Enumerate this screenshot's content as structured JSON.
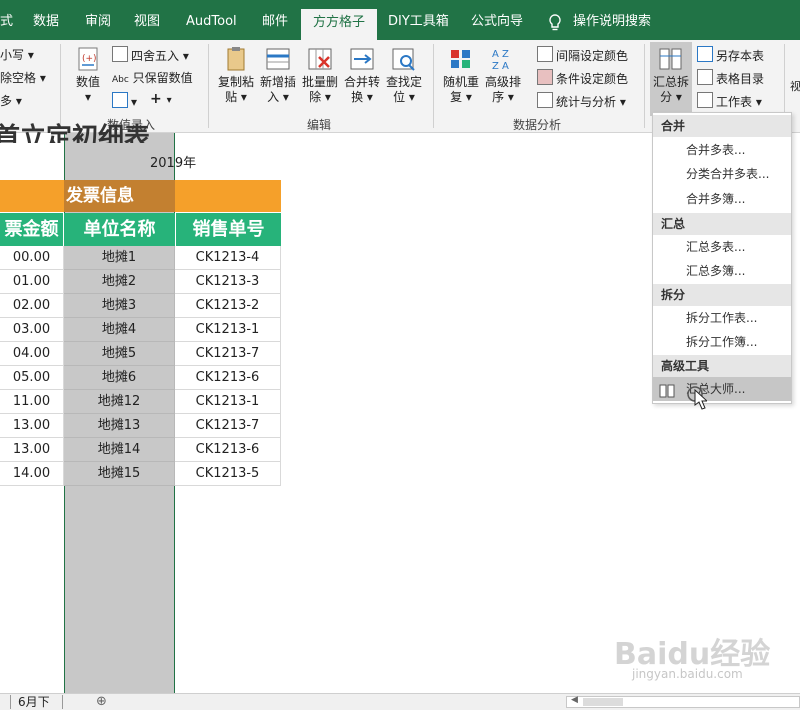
{
  "ribbon_tabs": [
    "式",
    "数据",
    "审阅",
    "视图",
    "AudTool",
    "邮件",
    "方方格子",
    "DIY工具箱",
    "公式向导",
    "操作说明搜索"
  ],
  "ribbon": {
    "left_items": [
      "小写",
      "除空格",
      "多"
    ],
    "numeric_group": {
      "value_button": "数值",
      "round_label": "四舍五入",
      "abc_prefix": "Abc",
      "keep_value_label": "只保留数值",
      "plus": "+",
      "group_label": "数值录入"
    },
    "edit_group": {
      "buttons": [
        [
          "复制粘",
          "贴"
        ],
        [
          "新增插",
          "入"
        ],
        [
          "批量删",
          "除"
        ],
        [
          "合并转",
          "换"
        ],
        [
          "查找定",
          "位"
        ]
      ],
      "group_label": "编辑"
    },
    "analysis_group": {
      "buttons": [
        [
          "随机重",
          "复"
        ],
        [
          "高级排",
          "序"
        ]
      ],
      "items": [
        "间隔设定颜色",
        "条件设定颜色",
        "统计与分析"
      ],
      "group_label": "数据分析"
    },
    "summary_button": [
      "汇总拆",
      "分"
    ],
    "right_items": [
      "另存本表",
      "表格目录",
      "工作表"
    ],
    "edge_char": "视"
  },
  "sheet": {
    "title_partial": "首立定初细表",
    "year": "2019年",
    "section_header": "发票信息",
    "columns": [
      "票金额",
      "单位名称",
      "销售单号"
    ],
    "rows": [
      [
        "00.00",
        "地摊1",
        "CK1213-4"
      ],
      [
        "01.00",
        "地摊2",
        "CK1213-3"
      ],
      [
        "02.00",
        "地摊3",
        "CK1213-2"
      ],
      [
        "03.00",
        "地摊4",
        "CK1213-1"
      ],
      [
        "04.00",
        "地摊5",
        "CK1213-7"
      ],
      [
        "05.00",
        "地摊6",
        "CK1213-6"
      ],
      [
        "11.00",
        "地摊12",
        "CK1213-1"
      ],
      [
        "13.00",
        "地摊13",
        "CK1213-7"
      ],
      [
        "13.00",
        "地摊14",
        "CK1213-6"
      ],
      [
        "14.00",
        "地摊15",
        "CK1213-5"
      ]
    ]
  },
  "dropdown": {
    "sections": [
      {
        "header": "合并",
        "items": [
          "合并多表...",
          "分类合并多表...",
          "合并多簿..."
        ]
      },
      {
        "header": "汇总",
        "items": [
          "汇总多表...",
          "汇总多簿..."
        ]
      },
      {
        "header": "拆分",
        "items": [
          "拆分工作表...",
          "拆分工作簿..."
        ]
      },
      {
        "header": "高级工具",
        "items": [
          "汇总大师..."
        ]
      }
    ],
    "highlighted": "汇总大师..."
  },
  "status": {
    "sheet_tab": "6月下",
    "add_sheet": "⊕"
  },
  "watermark": {
    "main": "Baidu经验",
    "sub": "jingyan.baidu.com"
  },
  "colors": {
    "excel_green": "#217346",
    "header_orange": "#f5a02a",
    "header_green": "#27b37a",
    "selected_column": "#c8c8c8"
  }
}
